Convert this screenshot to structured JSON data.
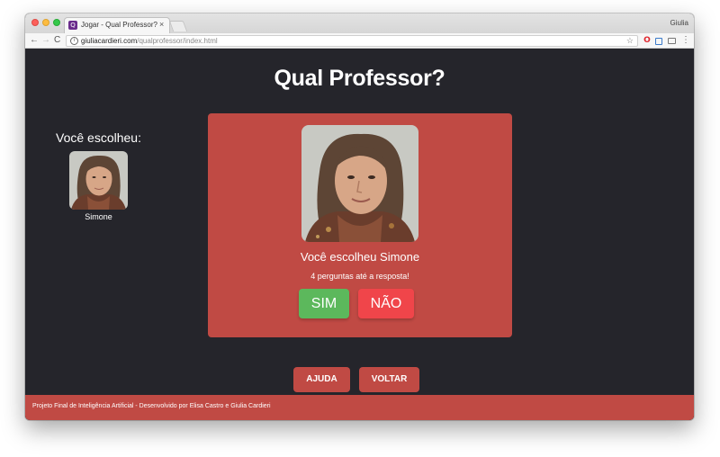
{
  "browser": {
    "tab_title": "Jogar - Qual Professor?",
    "tab_close": "×",
    "profile_name": "Giulia",
    "url_host": "giuliacardieri.com",
    "url_path": "/qualprofessor/index.html",
    "icons": {
      "favicon": "Q",
      "back": "←",
      "forward": "→",
      "reload": "C",
      "info": "i",
      "star": "☆",
      "opera": "O",
      "menu": "⋮"
    }
  },
  "page": {
    "title": "Qual Professor?",
    "sidebar": {
      "heading": "Você escolheu:",
      "name": "Simone"
    },
    "card": {
      "title": "Você escolheu Simone",
      "subtitle": "4 perguntas até a resposta!",
      "yes_label": "SIM",
      "no_label": "NÃO",
      "yes_color": "#5cb85c",
      "no_color": "#f0454a"
    },
    "help_label": "AJUDA",
    "back_label": "VOLTAR",
    "footer_text": "Projeto Final de Inteligência Artificial - Desenvolvido por Elisa Castro e Giulia Cardieri",
    "accent_color": "#c04a44",
    "background_color": "#25252b"
  }
}
